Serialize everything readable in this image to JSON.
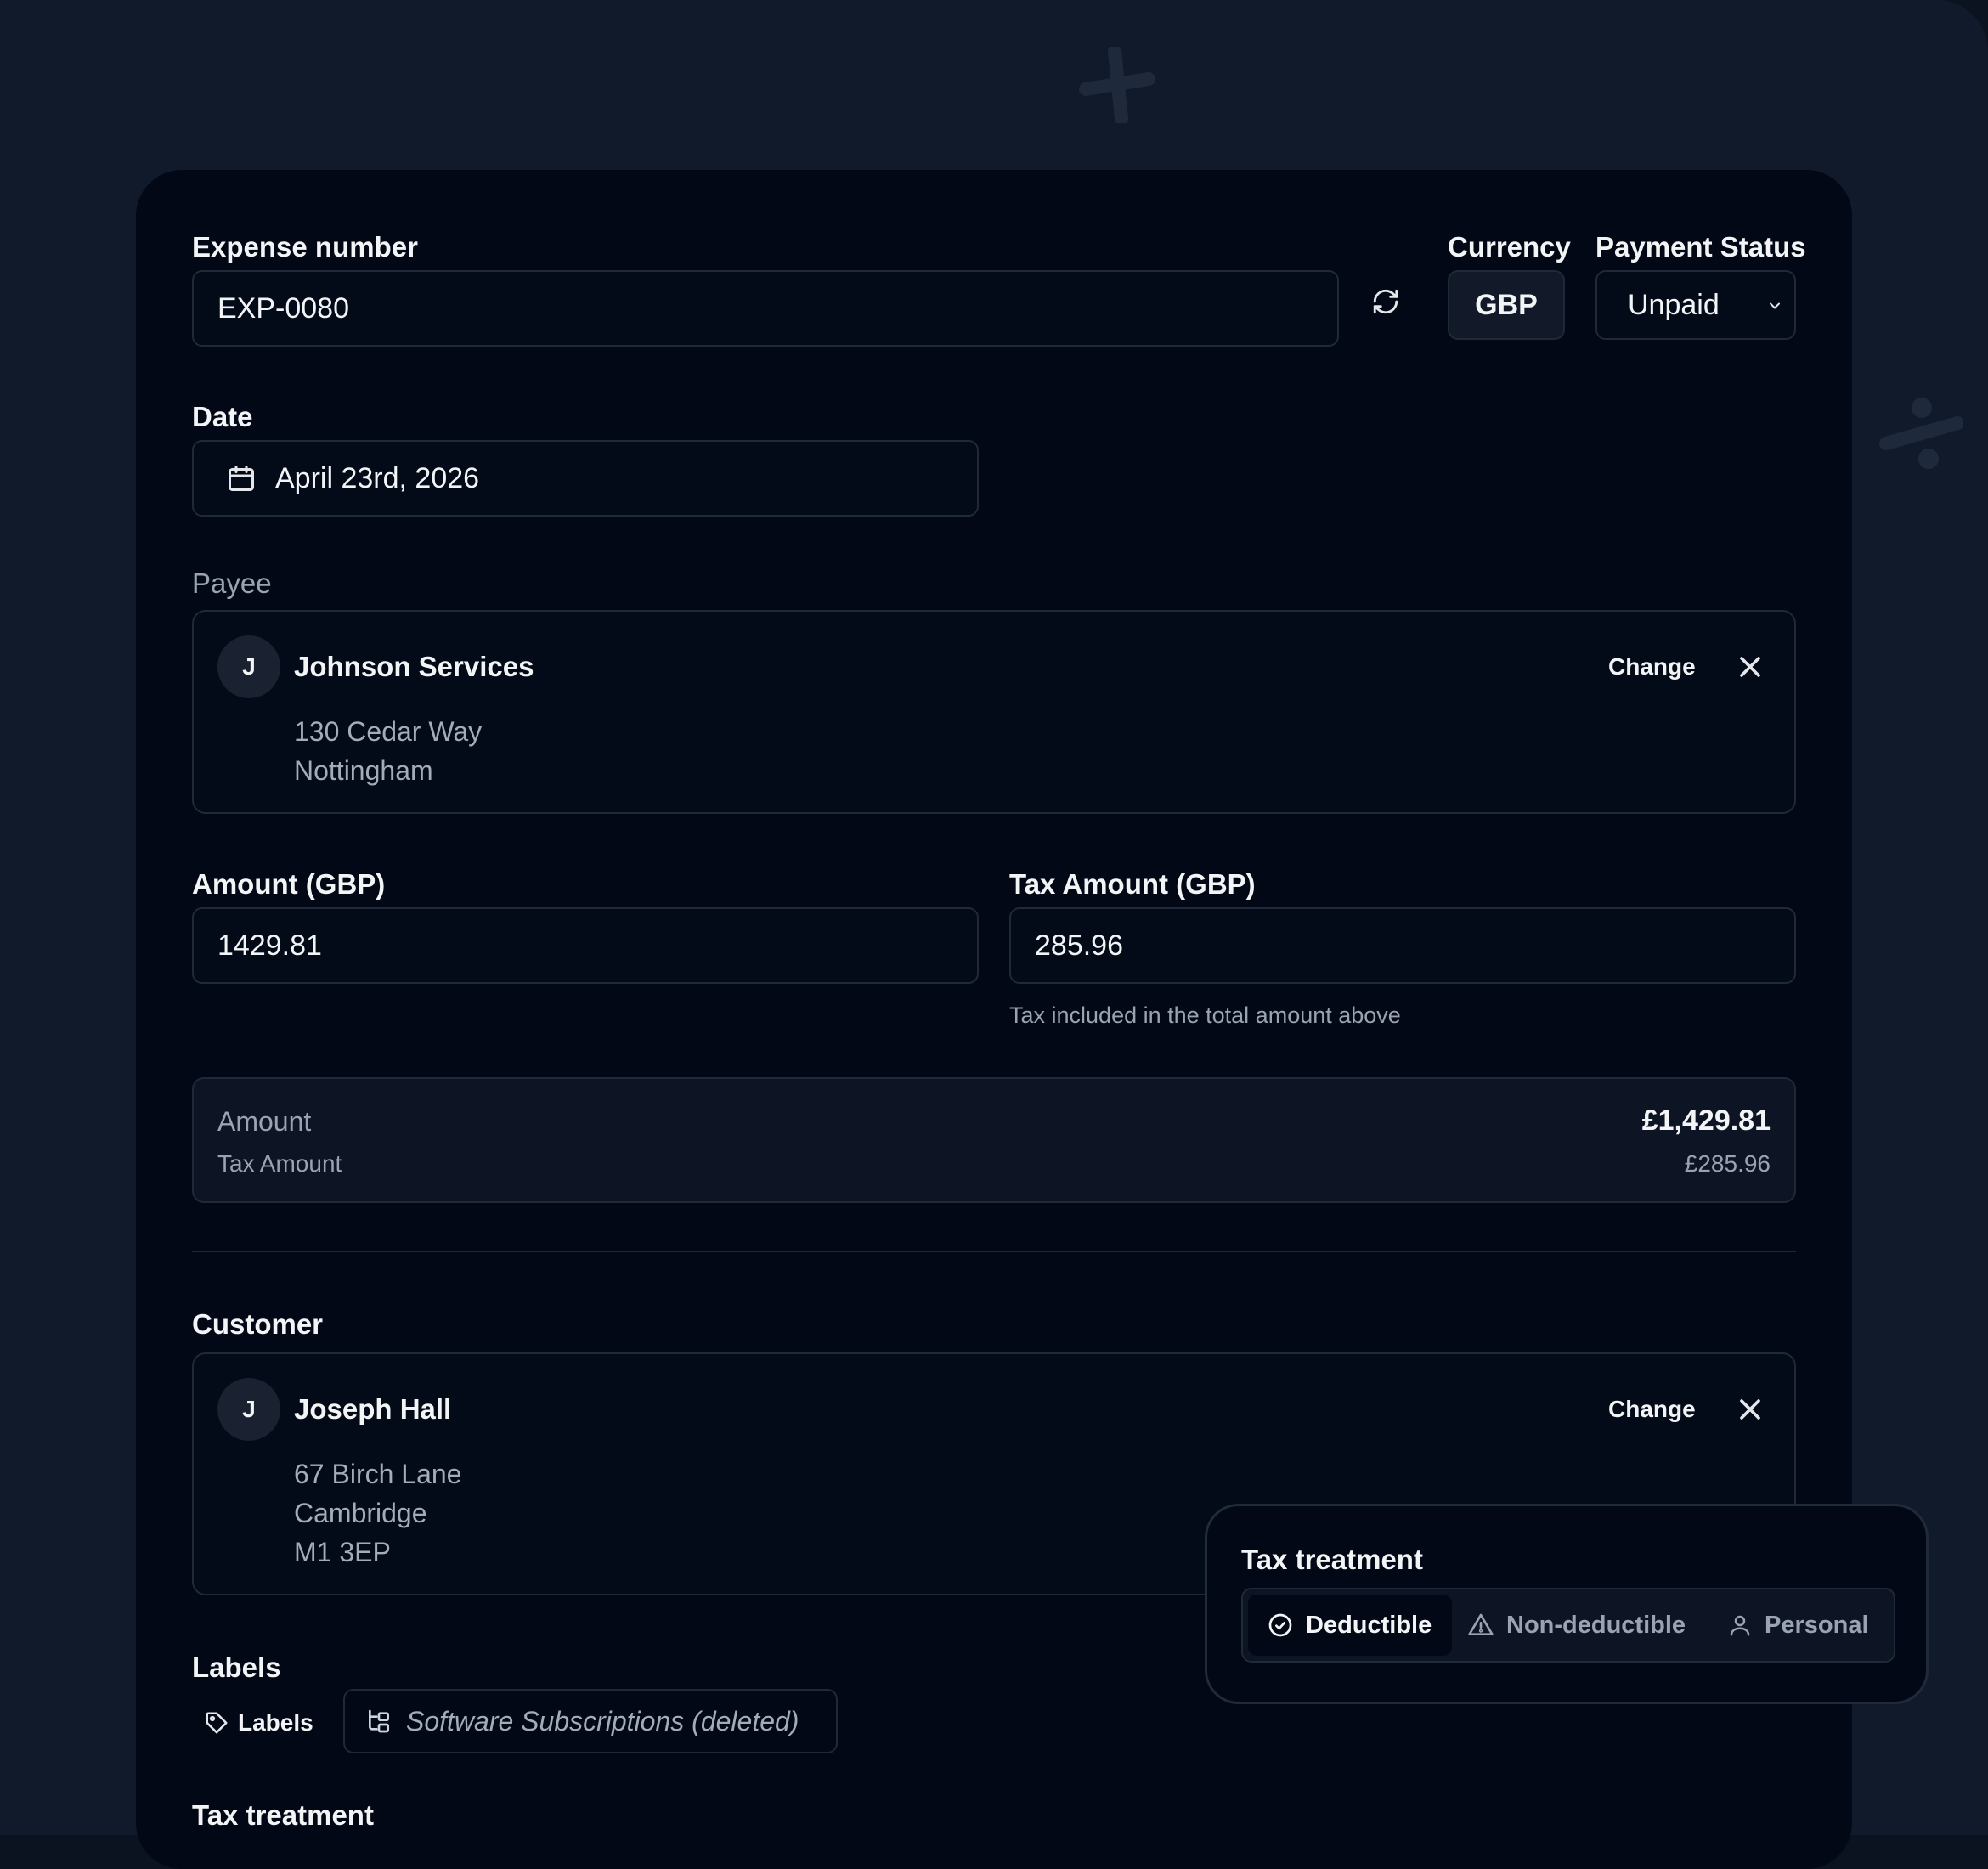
{
  "colors": {
    "background": "#111a2b",
    "card": "#020816",
    "border": "#1f2937",
    "text": "#f3f4f6",
    "muted": "#9aa3b2"
  },
  "expense": {
    "number_label": "Expense number",
    "number_value": "EXP-0080",
    "regenerate_icon": "refresh-icon",
    "currency_label": "Currency",
    "currency_value": "GBP",
    "status_label": "Payment Status",
    "status_value": "Unpaid"
  },
  "date": {
    "label": "Date",
    "value": "April 23rd, 2026",
    "icon": "calendar-icon"
  },
  "payee": {
    "label": "Payee",
    "initial": "J",
    "name": "Johnson Services",
    "address_line1": "130 Cedar Way",
    "address_line2": "Nottingham",
    "change_label": "Change"
  },
  "amounts": {
    "amount_label": "Amount (GBP)",
    "amount_value": "1429.81",
    "tax_label": "Tax Amount (GBP)",
    "tax_value": "285.96",
    "tax_hint": "Tax included in the total amount above"
  },
  "summary": {
    "amount_label": "Amount",
    "tax_label": "Tax Amount",
    "amount_value": "£1,429.81",
    "tax_value": "£285.96"
  },
  "customer": {
    "label": "Customer",
    "initial": "J",
    "name": "Joseph Hall",
    "address_line1": "67 Birch Lane",
    "address_line2": "Cambridge",
    "address_line3": "M1 3EP",
    "change_label": "Change"
  },
  "labels": {
    "label": "Labels",
    "button_label": "Labels",
    "chip": "Software Subscriptions (deleted)"
  },
  "tax_treatment": {
    "section_label": "Tax treatment",
    "popover_title": "Tax treatment",
    "options": [
      {
        "label": "Deductible",
        "icon": "check-circle-icon",
        "selected": true
      },
      {
        "label": "Non-deductible",
        "icon": "warning-icon",
        "selected": false
      },
      {
        "label": "Personal",
        "icon": "user-icon",
        "selected": false
      }
    ]
  }
}
